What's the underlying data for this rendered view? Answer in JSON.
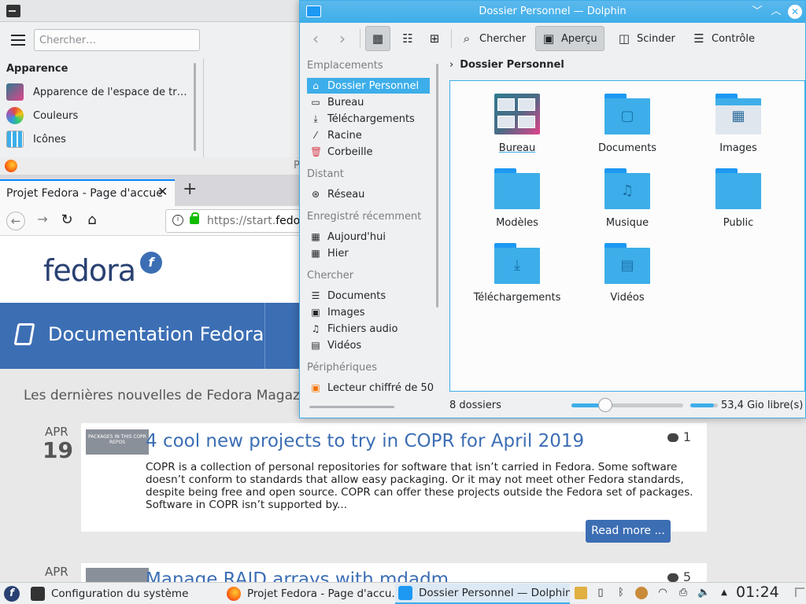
{
  "settings": {
    "search_placeholder": "Chercher…",
    "category": "Apparence",
    "items": [
      {
        "label": "Apparence de l'espace de tr…",
        "icon": "workspace-icon"
      },
      {
        "label": "Couleurs",
        "icon": "colors-icon"
      },
      {
        "label": "Icônes",
        "icon": "icons-icon"
      }
    ]
  },
  "firefox": {
    "title_fragment": "P",
    "tab_title": "Projet Fedora - Page d'accue",
    "url_prefix": "https://start.",
    "url_domain": "fedora",
    "logo_text": "fedora",
    "banner_title": "Documentation Fedora",
    "news_heading": "Les dernières nouvelles de Fedora Magazi",
    "articles": [
      {
        "month": "APR",
        "day": "19",
        "thumb_text": "PACKAGES IN THIS COPR REPOS",
        "title": "4 cool new projects to try in COPR for April 2019",
        "comments": "1",
        "body": "COPR is a collection of personal repositories for software that isn’t carried in Fedora. Some software doesn’t conform to standards that allow easy packaging. Or it may not meet other Fedora standards, despite being free and open source. COPR can offer these projects outside the Fedora set of packages. Software in COPR isn’t supported by...",
        "read_more": "Read more ..."
      },
      {
        "month": "APR",
        "title": "Manage RAID arrays with mdadm",
        "comments": "5"
      }
    ]
  },
  "dolphin": {
    "window_title": "Dossier Personnel — Dolphin",
    "toolbar": {
      "search": "Chercher",
      "preview": "Aperçu",
      "split": "Scinder",
      "control": "Contrôle"
    },
    "places_sections": {
      "places": "Emplacements",
      "remote": "Distant",
      "recent": "Enregistré récemment",
      "search": "Chercher",
      "devices": "Périphériques"
    },
    "places": [
      {
        "label": "Dossier Personnel",
        "icon": "home-icon"
      },
      {
        "label": "Bureau",
        "icon": "desktop-icon"
      },
      {
        "label": "Téléchargements",
        "icon": "download-icon"
      },
      {
        "label": "Racine",
        "icon": "root-icon"
      },
      {
        "label": "Corbeille",
        "icon": "trash-icon"
      }
    ],
    "remote": [
      {
        "label": "Réseau",
        "icon": "network-icon"
      }
    ],
    "recent": [
      {
        "label": "Aujourd'hui",
        "icon": "calendar-icon"
      },
      {
        "label": "Hier",
        "icon": "calendar-icon"
      }
    ],
    "search": [
      {
        "label": "Documents",
        "icon": "document-list-icon"
      },
      {
        "label": "Images",
        "icon": "image-icon"
      },
      {
        "label": "Fichiers audio",
        "icon": "audio-icon"
      },
      {
        "label": "Vidéos",
        "icon": "video-icon"
      }
    ],
    "devices": [
      {
        "label": "Lecteur chiffré de 50",
        "icon": "encrypted-drive-icon"
      }
    ],
    "breadcrumb": "Dossier Personnel",
    "files": [
      {
        "label": "Bureau",
        "icon": "desktop-folder-icon"
      },
      {
        "label": "Documents",
        "icon": "documents-folder-icon"
      },
      {
        "label": "Images",
        "icon": "pictures-folder-icon"
      },
      {
        "label": "Modèles",
        "icon": "templates-folder-icon"
      },
      {
        "label": "Musique",
        "icon": "music-folder-icon"
      },
      {
        "label": "Public",
        "icon": "public-folder-icon"
      },
      {
        "label": "Téléchargements",
        "icon": "downloads-folder-icon"
      },
      {
        "label": "Vidéos",
        "icon": "videos-folder-icon"
      }
    ],
    "status": "8 dossiers",
    "zoom_level": 0.3,
    "disk_usage": 0.85,
    "free_space": "53,4 Gio libre(s)",
    "accent_color": "#3daee9"
  },
  "taskbar": {
    "tasks": [
      {
        "label": "Configuration du système"
      },
      {
        "label": "Projet Fedora - Page d'accu…"
      },
      {
        "label": "Dossier Personnel — Dolphin"
      }
    ],
    "clock": "01:24"
  }
}
